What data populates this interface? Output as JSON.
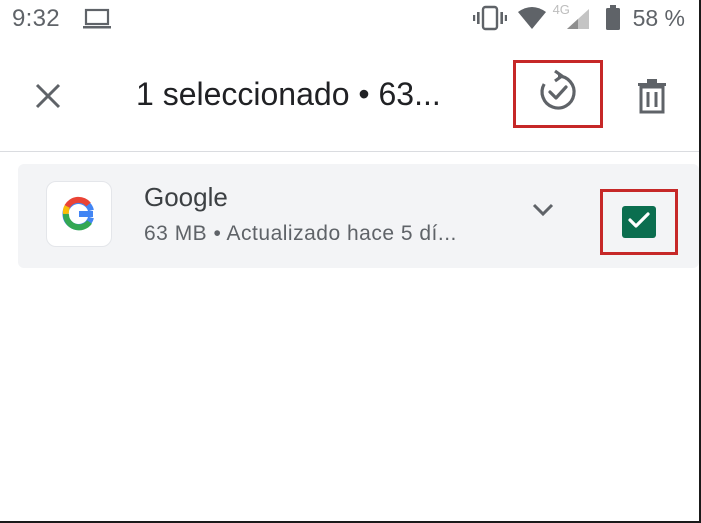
{
  "status_bar": {
    "time": "9:32",
    "laptop_icon": "laptop-icon",
    "vibrate_icon": "vibrate-icon",
    "wifi_icon": "wifi-icon",
    "network_label": "4G",
    "signal_icon": "signal-icon",
    "battery_icon": "battery-icon",
    "battery_percent": "58 %"
  },
  "toolbar": {
    "close_icon": "close-icon",
    "title": "1 seleccionado • 63...",
    "update_icon": "update-icon",
    "delete_icon": "trash-icon"
  },
  "apps": [
    {
      "name": "Google",
      "meta": "63 MB • Actualizado hace 5 dí...",
      "icon": "google-logo-icon",
      "expand_icon": "chevron-down-icon",
      "checked": true
    }
  ],
  "colors": {
    "highlight_border": "#c62828",
    "checkbox_fill": "#0b6e4f",
    "row_background": "#f3f4f6"
  }
}
